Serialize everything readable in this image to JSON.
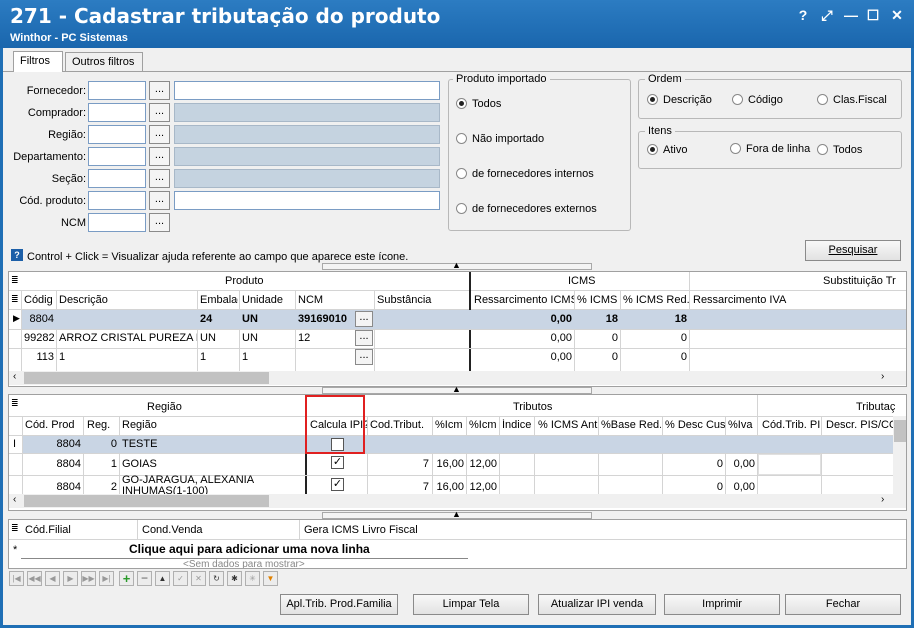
{
  "window": {
    "title": "271 - Cadastrar tributação do produto",
    "subtitle": "Winthor - PC Sistemas",
    "help": "?",
    "resize": "⤢",
    "min": "—",
    "max": "☐",
    "close": "✕"
  },
  "tabs": [
    "Filtros",
    "Outros filtros"
  ],
  "filters": {
    "labels": [
      "Fornecedor:",
      "Comprador:",
      "Região:",
      "Departamento:",
      "Seção:",
      "Cód. produto:",
      "NCM"
    ],
    "dots": "...",
    "help_text": "Control + Click = Visualizar ajuda referente ao campo que aparece este ícone.",
    "help_icon": "?"
  },
  "produto_importado": {
    "title": "Produto importado",
    "options": [
      "Todos",
      "Não importado",
      "de fornecedores internos",
      "de fornecedores externos"
    ],
    "selected": 0
  },
  "ordem": {
    "title": "Ordem",
    "options": [
      "Descrição",
      "Código",
      "Clas.Fiscal"
    ],
    "selected": 0
  },
  "itens": {
    "title": "Itens",
    "options": [
      "Ativo",
      "Fora de linha",
      "Todos"
    ],
    "selected": 0
  },
  "pesquisar": "Pesquisar",
  "grid1": {
    "groups": [
      "Produto",
      "ICMS",
      "Substituição Tr"
    ],
    "columns": [
      "Códig",
      "Descrição",
      "Embalag",
      "Unidade",
      "NCM",
      "Substância",
      "Ressarcimento ICMS",
      "% ICMS",
      "% ICMS Red.",
      "Ressarcimento IVA"
    ],
    "rows": [
      {
        "cod": "8804",
        "desc": "",
        "emb": "24",
        "un": "UN",
        "ncm": "39169010",
        "sub": "",
        "ress": "0,00",
        "icms": "18",
        "red": "18",
        "iva": ""
      },
      {
        "cod": "99282",
        "desc": "ARROZ  CRISTAL PUREZA E",
        "emb": "UN",
        "un": "UN",
        "ncm": "12",
        "sub": "",
        "ress": "0,00",
        "icms": "0",
        "red": "0",
        "iva": ""
      },
      {
        "cod": "113",
        "desc": "1",
        "emb": "1",
        "un": "1",
        "ncm": "",
        "sub": "",
        "ress": "0,00",
        "icms": "0",
        "red": "0",
        "iva": ""
      }
    ]
  },
  "grid2": {
    "groups": [
      "Região",
      "Tributos",
      "Tributaç"
    ],
    "columns": [
      "Cód. Prod",
      "Reg.",
      "Região",
      "Calcula IPI?",
      "Cod.Tribut.",
      "%Icm",
      "%Icm",
      "Índice",
      "% ICMS Ant",
      "%Base Red.",
      "% Desc Cus",
      "%Iva",
      "Cód.Trib. PI",
      "Descr. PIS/CO"
    ],
    "rows": [
      {
        "cod": "8804",
        "reg": "0",
        "regiao": "TESTE",
        "ipi": false,
        "trib": "",
        "icm1": "",
        "icm2": "",
        "ind": "",
        "ant": "",
        "base": "",
        "desc": "",
        "iva": ""
      },
      {
        "cod": "8804",
        "reg": "1",
        "regiao": "GOIAS",
        "ipi": true,
        "trib": "7",
        "icm1": "16,00",
        "icm2": "12,00",
        "ind": "",
        "ant": "",
        "base": "",
        "desc": "0",
        "iva": "0,00"
      },
      {
        "cod": "8804",
        "reg": "2",
        "regiao": "GO-JARAGUA, ALEXANIA INHUMAS(1-100)",
        "ipi": true,
        "trib": "7",
        "icm1": "16,00",
        "icm2": "12,00",
        "ind": "",
        "ant": "",
        "base": "",
        "desc": "0",
        "iva": "0,00"
      }
    ]
  },
  "grid3": {
    "columns": [
      "Cód.Filial",
      "Cond.Venda",
      "Gera ICMS Livro Fiscal"
    ],
    "add_row": "Clique aqui para adicionar uma nova linha",
    "empty": "<Sem dados para mostrar>"
  },
  "buttons": [
    "Apl.Trib. Prod.Familia",
    "Limpar Tela",
    "Atualizar IPI venda",
    "Imprimir",
    "Fechar"
  ],
  "highlight_color": "#e02020",
  "selected_row_color": "#c9d5e4"
}
